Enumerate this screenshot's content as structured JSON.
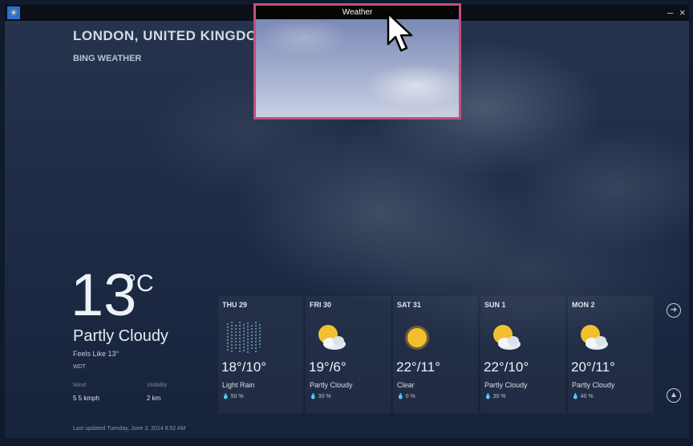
{
  "window": {
    "minimize_glyph": "–",
    "close_glyph": "×"
  },
  "header": {
    "city": "LONDON, UNITED KINGDOM",
    "provider": "BING WEATHER"
  },
  "current": {
    "temperature": "13",
    "unit": "°C",
    "condition": "Partly Cloudy",
    "feels_like": "Feels Like 13°",
    "station": "WDT",
    "wind_label": "Wind",
    "wind_value": "5 5 kmph",
    "visibility_label": "Visibility",
    "visibility_value": "2 km",
    "last_updated": "Last updated Tuesday, June 3, 2014 8:52 AM"
  },
  "forecast": [
    {
      "day": "THU 29",
      "temp": "18°/10°",
      "desc": "Light Rain",
      "precip": "50 %",
      "icon": "rain-icon"
    },
    {
      "day": "FRI 30",
      "temp": "19°/6°",
      "desc": "Partly Cloudy",
      "precip": "30 %",
      "icon": "partly-cloudy-icon"
    },
    {
      "day": "SAT 31",
      "temp": "22°/11°",
      "desc": "Clear",
      "precip": "0 %",
      "icon": "sun-icon"
    },
    {
      "day": "SUN 1",
      "temp": "22°/10°",
      "desc": "Partly Cloudy",
      "precip": "30 %",
      "icon": "partly-cloudy-icon"
    },
    {
      "day": "MON 2",
      "temp": "20°/11°",
      "desc": "Partly Cloudy",
      "precip": "40 %",
      "icon": "partly-cloudy-icon"
    }
  ],
  "preview": {
    "title": "Weather"
  },
  "colors": {
    "accent_border": "#c24f7e",
    "background": "#1f2c46"
  }
}
